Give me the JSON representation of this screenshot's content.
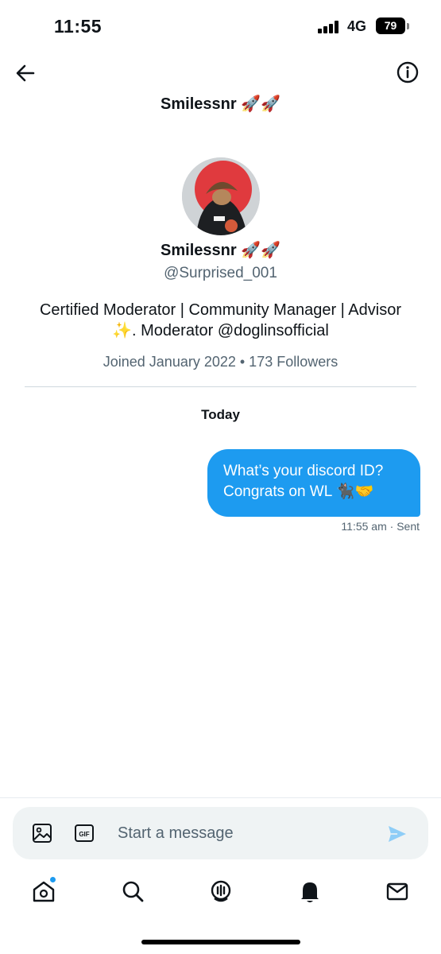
{
  "status_bar": {
    "time": "11:55",
    "network": "4G",
    "battery": "79"
  },
  "header": {
    "title": "Smilessnr 🚀🚀",
    "back_icon": "arrow-left-icon",
    "info_icon": "info-circle-icon"
  },
  "profile": {
    "name": "Smilessnr 🚀🚀",
    "handle": "@Surprised_001",
    "bio_line1": "Certified Moderator | Community Manager | Advisor",
    "bio_line2": "✨.   Moderator @doglinsofficial",
    "meta": "Joined January 2022 • 173 Followers"
  },
  "conversation": {
    "date_label": "Today",
    "messages": [
      {
        "line1": "What’s your discord ID?",
        "line2": "Congrats on WL 🐈‍⬛🤝",
        "time": "11:55 am",
        "status": "· Sent"
      }
    ]
  },
  "composer": {
    "placeholder": "Start a message",
    "image_icon": "image-icon",
    "gif_icon": "gif-icon",
    "send_icon": "send-icon"
  },
  "nav": {
    "items": [
      "home-icon",
      "search-icon",
      "spaces-icon",
      "notifications-icon",
      "messages-icon"
    ]
  },
  "colors": {
    "accent": "#1d9bf0",
    "text_secondary": "#536471"
  }
}
